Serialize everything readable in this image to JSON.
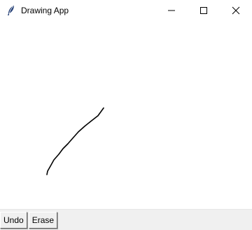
{
  "window": {
    "title": "Drawing App",
    "icon": "feather-icon"
  },
  "title_controls": {
    "minimize_icon": "minimize-icon",
    "maximize_icon": "maximize-icon",
    "close_icon": "close-icon"
  },
  "toolbar": {
    "undo_label": "Undo",
    "erase_label": "Erase"
  },
  "colors": {
    "titlebar_bg": "#ffffff",
    "canvas_bg": "#ffffff",
    "toolbar_bg": "#f0f0f0",
    "stroke_color": "#000000"
  }
}
